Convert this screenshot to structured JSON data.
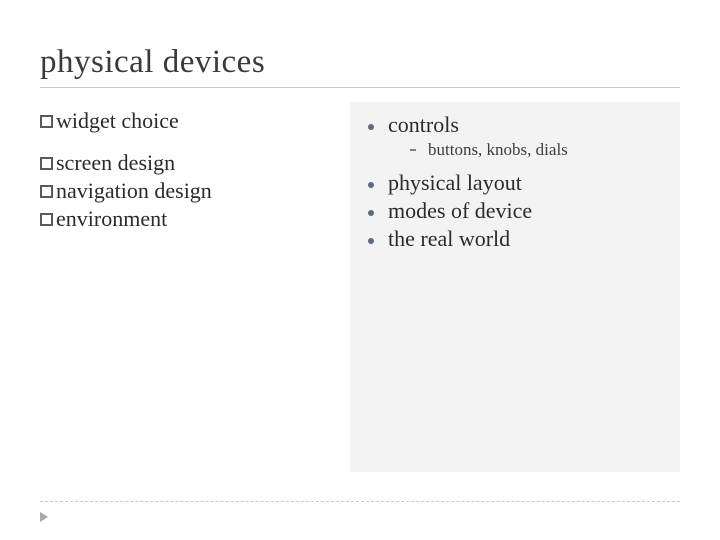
{
  "title": "physical devices",
  "left": {
    "items": [
      {
        "label": "widget choice"
      },
      {
        "label": "screen design"
      },
      {
        "label": "navigation design"
      },
      {
        "label": "environment"
      }
    ]
  },
  "right": {
    "items": [
      {
        "label": "controls",
        "sub": [
          {
            "label": "buttons, knobs, dials"
          }
        ]
      },
      {
        "label": "physical layout"
      },
      {
        "label": "modes of device"
      },
      {
        "label": "the real world"
      }
    ]
  }
}
